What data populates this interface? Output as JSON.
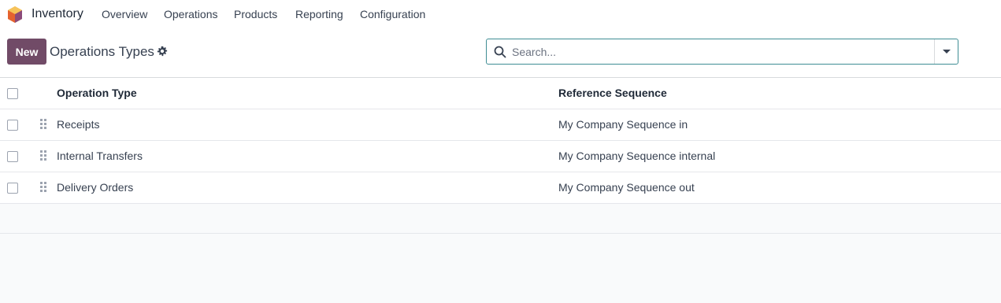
{
  "navbar": {
    "app_name": "Inventory",
    "menu": [
      "Overview",
      "Operations",
      "Products",
      "Reporting",
      "Configuration"
    ]
  },
  "control_panel": {
    "new_label": "New",
    "title": "Operations Types",
    "search_placeholder": "Search..."
  },
  "table": {
    "columns": [
      "Operation Type",
      "Reference Sequence"
    ],
    "rows": [
      {
        "operation_type": "Receipts",
        "reference_sequence": "My Company Sequence in"
      },
      {
        "operation_type": "Internal Transfers",
        "reference_sequence": "My Company Sequence internal"
      },
      {
        "operation_type": "Delivery Orders",
        "reference_sequence": "My Company Sequence out"
      }
    ]
  },
  "colors": {
    "brand": "#714b67",
    "search_border": "#3f8d94"
  },
  "icons": [
    "app-logo-icon",
    "gear-icon",
    "search-icon",
    "dropdown-caret-icon",
    "drag-handle-icon"
  ]
}
